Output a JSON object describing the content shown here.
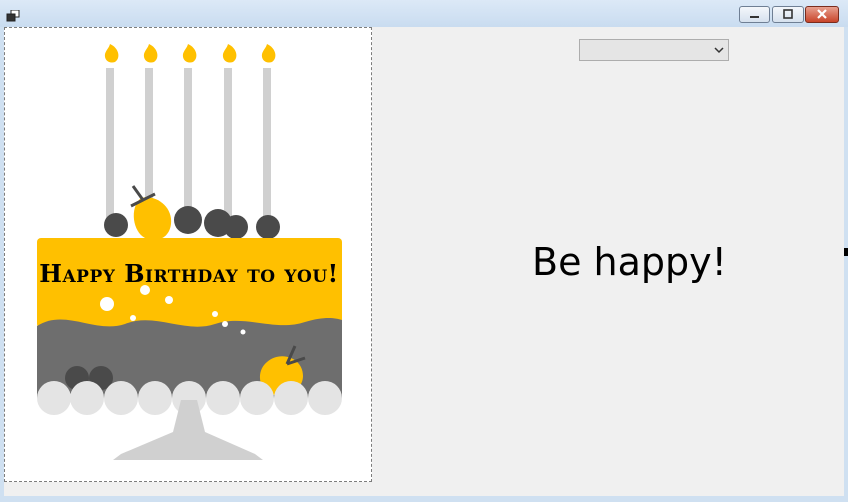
{
  "window": {
    "title": "",
    "buttons": {
      "minimize": "minimize",
      "maximize": "maximize",
      "close": "close"
    }
  },
  "picture": {
    "caption": "Happy Birthday to you!"
  },
  "combo": {
    "selected": "",
    "icon": "chevron-down-icon"
  },
  "message": {
    "text": "Be happy!"
  },
  "colors": {
    "accent_yellow": "#FFC000",
    "cake_gray": "#6E6E6E",
    "candle_gray": "#D0D0D0",
    "berry_dark": "#4A4A4A"
  }
}
